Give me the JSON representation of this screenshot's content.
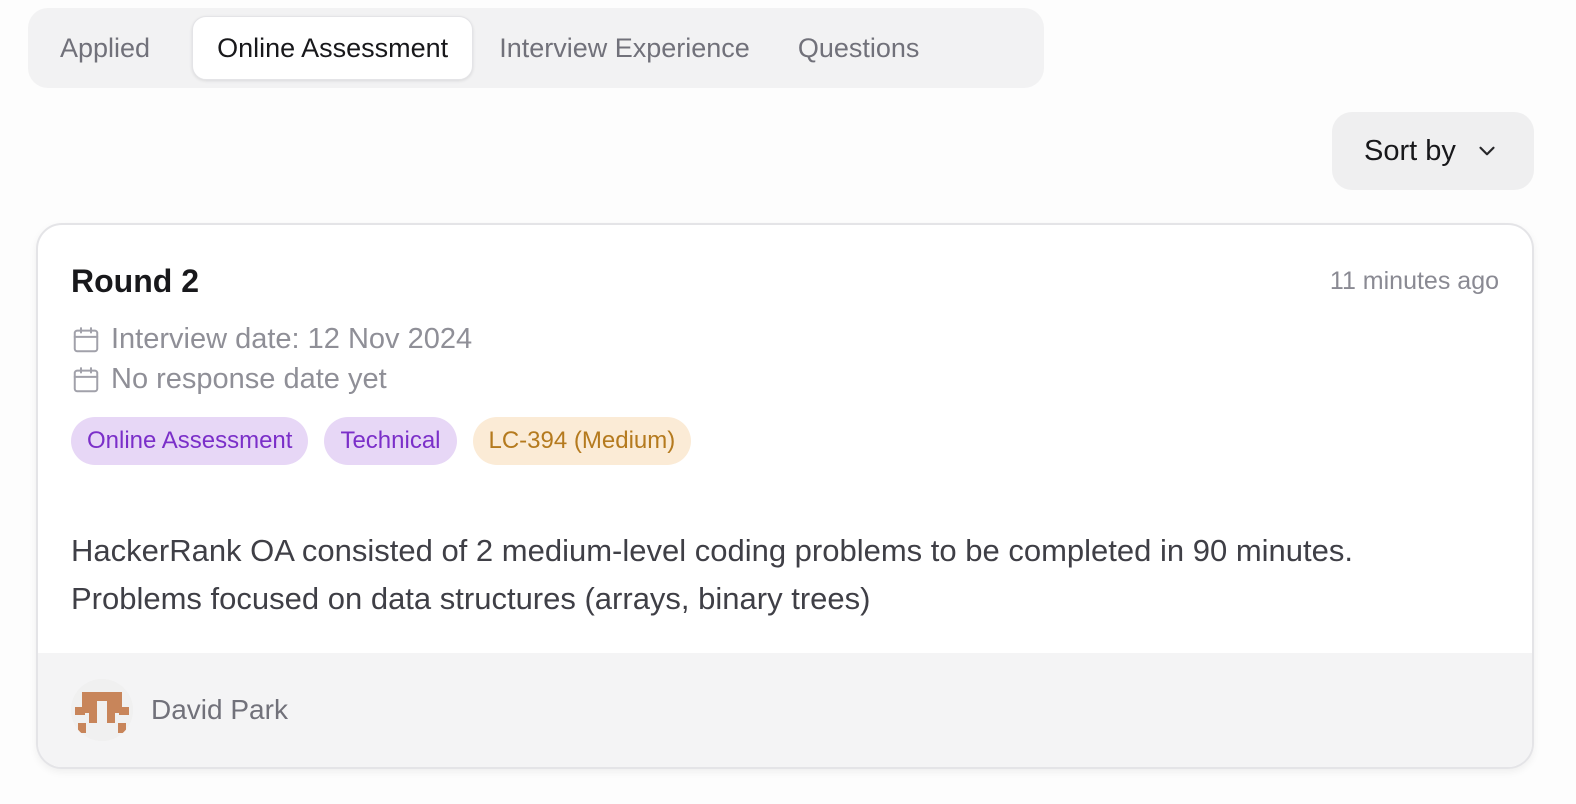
{
  "tabs": [
    {
      "label": "Applied"
    },
    {
      "label": "Online Assessment"
    },
    {
      "label": "Interview Experience"
    },
    {
      "label": "Questions"
    }
  ],
  "sort": {
    "label": "Sort by"
  },
  "card": {
    "title": "Round 2",
    "timestamp": "11 minutes ago",
    "interview_date": "Interview date: 12 Nov 2024",
    "response_date": "No response date yet",
    "tags": [
      "Online Assessment",
      "Technical",
      "LC-394 (Medium)"
    ],
    "body_line1": "HackerRank OA consisted of 2 medium-level coding problems to be completed in 90 minutes.",
    "body_line2": "Problems focused on data structures (arrays, binary trees)",
    "author": "David Park"
  },
  "colors": {
    "tag_purple_bg": "#e7d7f6",
    "tag_purple_text": "#7b2fc9",
    "tag_orange_bg": "#fbebd6",
    "tag_orange_text": "#b57a1e",
    "avatar_color": "#c8855a"
  }
}
